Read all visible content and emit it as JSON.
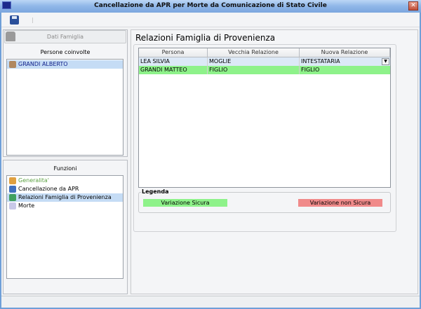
{
  "window": {
    "title": "Cancellazione da APR per Morte da Comunicazione di Stato Civile",
    "close": "✕"
  },
  "left": {
    "dati_famiglia": "Dati Famiglia",
    "persone_label": "Persone coinvolte",
    "persone": [
      {
        "name": "GRANDI ALBERTO",
        "selected": true
      }
    ],
    "funzioni_label": "Funzioni",
    "funzioni": [
      {
        "label": "Generalita'",
        "color": "#5aa040"
      },
      {
        "label": "Cancellazione da APR"
      },
      {
        "label": "Relazioni Famiglia di Provenienza",
        "selected": true
      },
      {
        "label": "Morte"
      }
    ]
  },
  "main": {
    "title": "Relazioni Famiglia di Provenienza",
    "columns": [
      "Persona",
      "Vecchia Relazione",
      "Nuova Relazione"
    ],
    "rows": [
      {
        "persona": "LEA SILVIA",
        "vecchia": "MOGLIE",
        "nuova": "INTESTATARIA",
        "bg": "#dce9f7"
      },
      {
        "persona": "GRANDI MATTEO",
        "vecchia": "FIGLIO",
        "nuova": "FIGLIO",
        "bg": "#8ef28a"
      }
    ],
    "legend": {
      "title": "Legenda",
      "safe": "Variazione Sicura",
      "unsafe": "Variazione non Sicura",
      "safe_color": "#8ef28a",
      "unsafe_color": "#f08a8a"
    }
  }
}
